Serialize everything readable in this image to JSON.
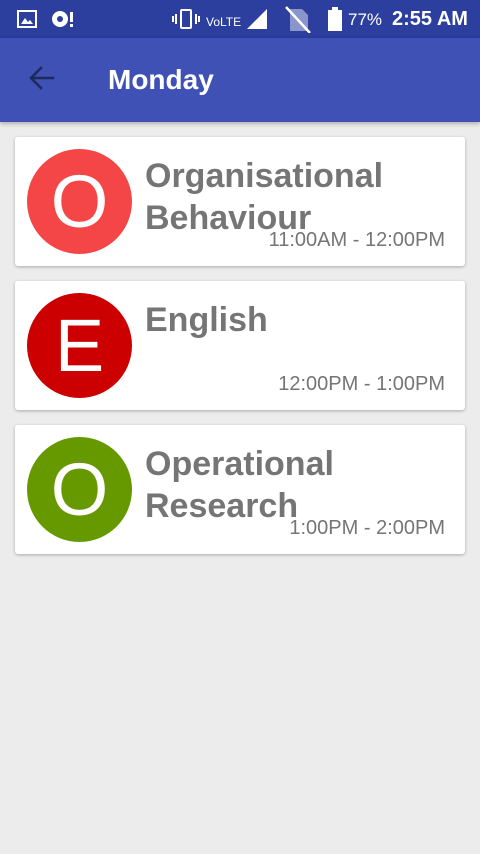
{
  "status_bar": {
    "network": "VoLTE",
    "battery": "77%",
    "time": "2:55 AM"
  },
  "app_bar": {
    "title": "Monday",
    "back_icon": "arrow-back-icon"
  },
  "colors": {
    "status_bar": "#2c3e9e",
    "app_bar": "#3f51b5",
    "background": "#ececec"
  },
  "classes": [
    {
      "letter": "O",
      "subject": "Organisational Behaviour",
      "time": "11:00AM - 12:00PM",
      "color": "#f44646"
    },
    {
      "letter": "E",
      "subject": "English",
      "time": "12:00PM - 1:00PM",
      "color": "#cc0000"
    },
    {
      "letter": "O",
      "subject": "Operational Research",
      "time": "1:00PM - 2:00PM",
      "color": "#669900"
    }
  ]
}
